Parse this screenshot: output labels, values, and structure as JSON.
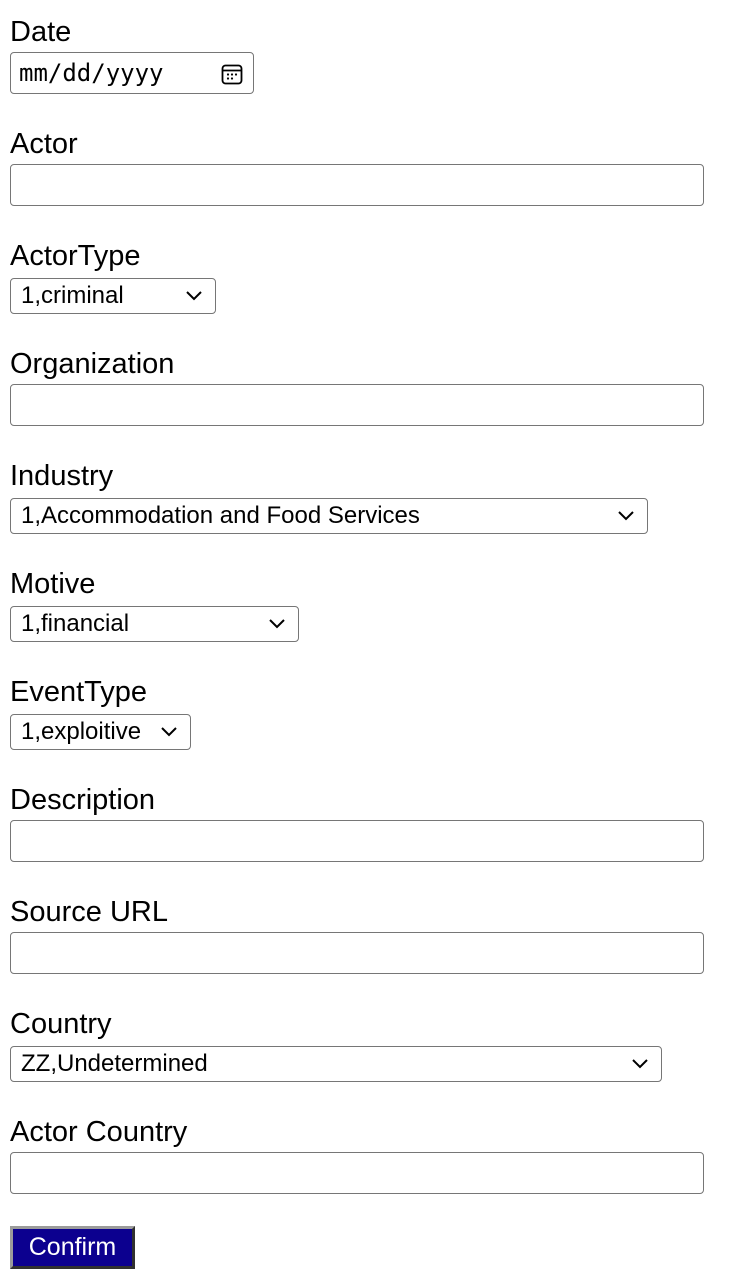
{
  "form": {
    "date": {
      "label": "Date",
      "placeholder": "mm/dd/yyyy"
    },
    "actor": {
      "label": "Actor",
      "value": ""
    },
    "actor_type": {
      "label": "ActorType",
      "selected": "1,criminal"
    },
    "organization": {
      "label": "Organization",
      "value": ""
    },
    "industry": {
      "label": "Industry",
      "selected": "1,Accommodation and Food Services"
    },
    "motive": {
      "label": "Motive",
      "selected": "1,financial"
    },
    "event_type": {
      "label": "EventType",
      "selected": "1,exploitive"
    },
    "description": {
      "label": "Description",
      "value": ""
    },
    "source_url": {
      "label": "Source URL",
      "value": ""
    },
    "country": {
      "label": "Country",
      "selected": "ZZ,Undetermined"
    },
    "actor_country": {
      "label": "Actor Country",
      "value": ""
    },
    "confirm_label": "Confirm"
  },
  "icons": {
    "calendar": "calendar-icon",
    "dropdown": "chevron-down-icon"
  },
  "colors": {
    "button_bg": "#0c008f",
    "button_text": "#ffffff",
    "input_border": "#767676"
  }
}
